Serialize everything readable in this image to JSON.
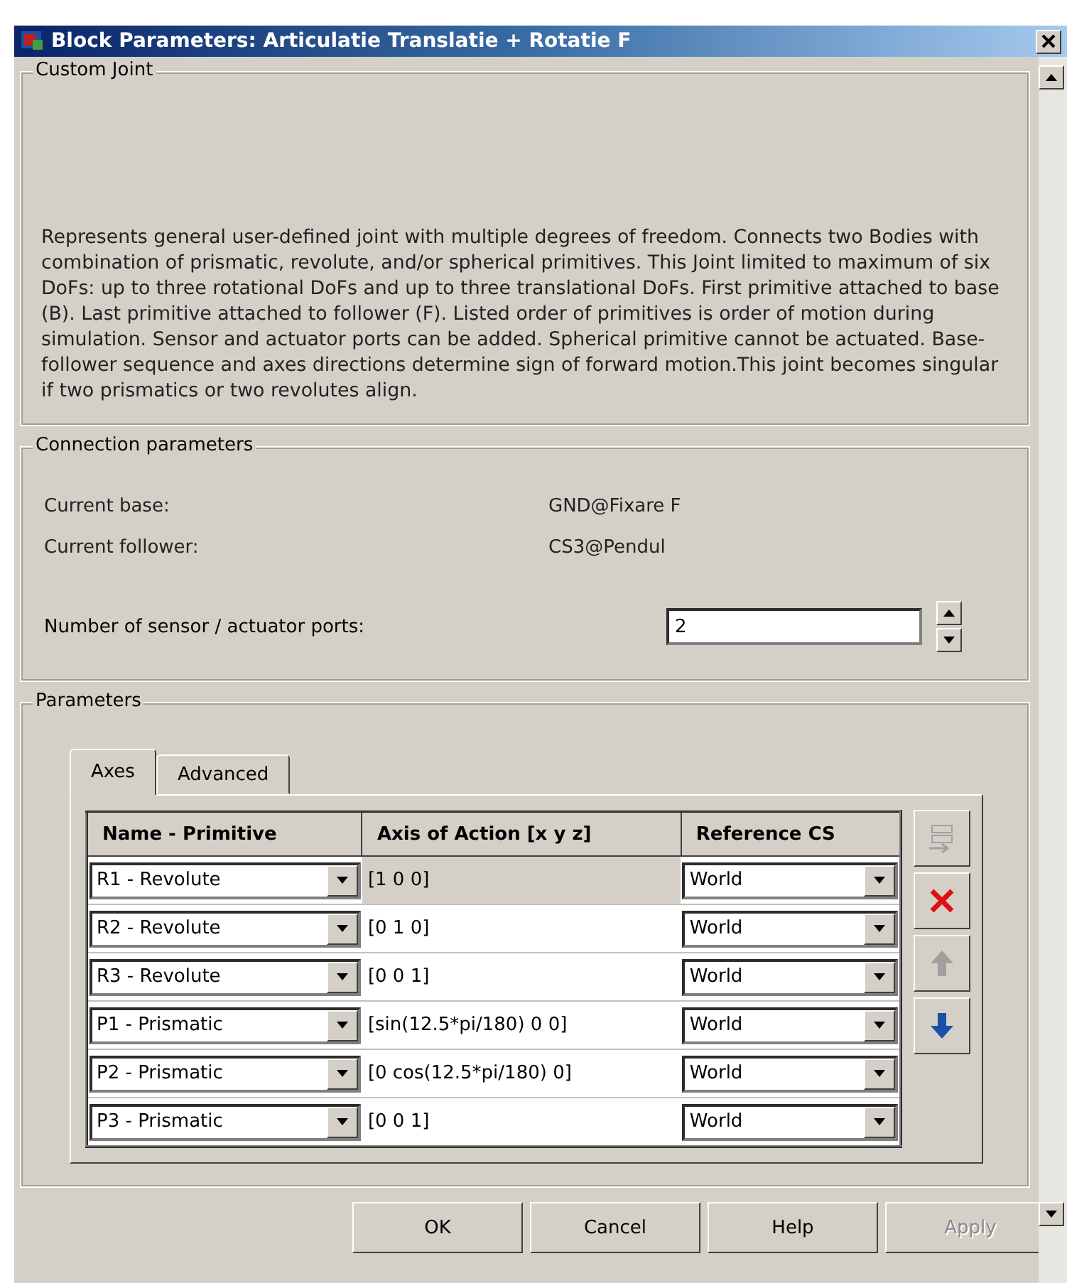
{
  "window": {
    "title": "Block Parameters: Articulatie Translatie + Rotatie F"
  },
  "description_group": {
    "title": "Custom Joint",
    "text": "Represents general user-defined joint with multiple degrees of freedom. Connects two Bodies with combination of prismatic, revolute, and/or spherical primitives. This Joint limited to maximum of six DoFs: up to three rotational DoFs and up to three translational DoFs. First primitive attached to base (B). Last primitive attached to follower (F). Listed order of primitives is order of motion during simulation. Sensor and actuator ports can be added. Spherical primitive cannot be actuated. Base-follower sequence and axes directions determine sign of forward motion.This joint becomes singular if two prismatics or two revolutes align."
  },
  "connection_group": {
    "title": "Connection parameters",
    "fields": [
      {
        "label": "Current base:",
        "value": "GND@Fixare F"
      },
      {
        "label": "Current follower:",
        "value": "CS3@Pendul"
      }
    ],
    "ports": {
      "label": "Number of sensor / actuator ports:",
      "value": "2"
    }
  },
  "parameters_group": {
    "title": "Parameters",
    "tabs": [
      {
        "label": "Axes",
        "selected": true
      },
      {
        "label": "Advanced",
        "selected": false
      }
    ],
    "table": {
      "columns": [
        "Name - Primitive",
        "Axis of Action [x y z]",
        "Reference CS"
      ],
      "rows": [
        {
          "primitive": "R1 - Revolute",
          "axis": "[1 0 0]",
          "reference": "World",
          "selected": true
        },
        {
          "primitive": "R2 - Revolute",
          "axis": "[0 1 0]",
          "reference": "World",
          "selected": false
        },
        {
          "primitive": "R3 - Revolute",
          "axis": "[0 0 1]",
          "reference": "World",
          "selected": false
        },
        {
          "primitive": "P1 - Prismatic",
          "axis": "[sin(12.5*pi/180) 0 0]",
          "reference": "World",
          "selected": false
        },
        {
          "primitive": "P2 - Prismatic",
          "axis": "[0 cos(12.5*pi/180) 0]",
          "reference": "World",
          "selected": false
        },
        {
          "primitive": "P3 - Prismatic",
          "axis": "[0 0 1]",
          "reference": "World",
          "selected": false
        }
      ]
    },
    "side_buttons": [
      {
        "kind": "insert",
        "disabled": true
      },
      {
        "kind": "delete",
        "disabled": false
      },
      {
        "kind": "up",
        "disabled": true
      },
      {
        "kind": "down",
        "disabled": false
      }
    ]
  },
  "buttons": [
    {
      "label": "OK",
      "disabled": false
    },
    {
      "label": "Cancel",
      "disabled": false
    },
    {
      "label": "Help",
      "disabled": false
    },
    {
      "label": "Apply",
      "disabled": true
    }
  ]
}
